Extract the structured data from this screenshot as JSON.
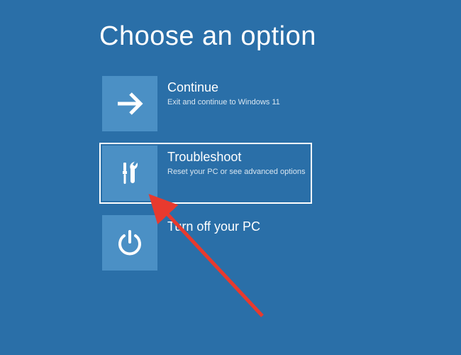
{
  "title": "Choose an option",
  "options": [
    {
      "icon": "arrow-right-icon",
      "title": "Continue",
      "desc": "Exit and continue to Windows 11",
      "selected": false
    },
    {
      "icon": "tools-icon",
      "title": "Troubleshoot",
      "desc": "Reset your PC or see advanced options",
      "selected": true
    },
    {
      "icon": "power-icon",
      "title": "Turn off your PC",
      "desc": "",
      "selected": false
    }
  ],
  "annotation": {
    "type": "arrow",
    "color": "#e83a2e"
  }
}
